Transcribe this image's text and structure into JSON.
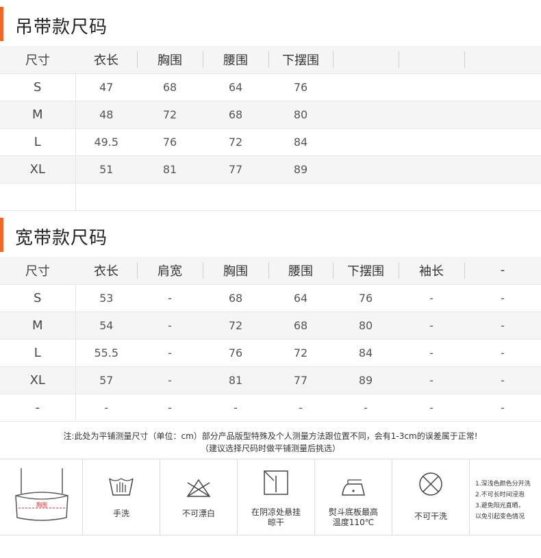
{
  "section1": {
    "title": "吊带款尺码",
    "headers": [
      "尺寸",
      "衣长",
      "胸围",
      "腰围",
      "下摆围",
      "",
      "",
      ""
    ],
    "rows": [
      [
        "S",
        "47",
        "68",
        "64",
        "76",
        "",
        "",
        ""
      ],
      [
        "M",
        "48",
        "72",
        "68",
        "80",
        "",
        "",
        ""
      ],
      [
        "L",
        "49.5",
        "76",
        "72",
        "84",
        "",
        "",
        ""
      ],
      [
        "XL",
        "51",
        "81",
        "77",
        "89",
        "",
        "",
        ""
      ],
      [
        "",
        "",
        "",
        "",
        "",
        "",
        "",
        ""
      ]
    ]
  },
  "section2": {
    "title": "宽带款尺码",
    "headers": [
      "尺寸",
      "衣长",
      "肩宽",
      "胸围",
      "腰围",
      "下摆围",
      "袖长",
      "-"
    ],
    "rows": [
      [
        "S",
        "53",
        "-",
        "68",
        "64",
        "76",
        "-",
        "-"
      ],
      [
        "M",
        "54",
        "-",
        "72",
        "68",
        "80",
        "-",
        "-"
      ],
      [
        "L",
        "55.5",
        "-",
        "76",
        "72",
        "84",
        "-",
        "-"
      ],
      [
        "XL",
        "57",
        "-",
        "81",
        "77",
        "89",
        "-",
        "-"
      ],
      [
        "-",
        "-",
        "-",
        "-",
        "-",
        "-",
        "-",
        "-"
      ]
    ]
  },
  "note": {
    "line1": "注:此处为平铺测量尺寸（单位：cm）部分产品版型特殊及个人测量方法跟位置不同，会有1-3cm的误差属于正常!",
    "line2": "（建议选择尺码时做平铺测量后挑选）"
  },
  "care": {
    "garment_label": "胸围",
    "items": [
      {
        "name": "hand-wash",
        "label": "手洗"
      },
      {
        "name": "no-bleach",
        "label": "不可漂白"
      },
      {
        "name": "shade-dry",
        "label": "在阴凉处悬挂晾干"
      },
      {
        "name": "iron",
        "label": "熨斗底板最高温度110℃"
      },
      {
        "name": "no-dry-clean",
        "label": "不可干洗"
      }
    ],
    "tips": [
      "1.深浅色颜色分开洗",
      "2.不可长时间浸泡",
      "3.避免阳光直晒，",
      "以免引起变色情况"
    ]
  }
}
